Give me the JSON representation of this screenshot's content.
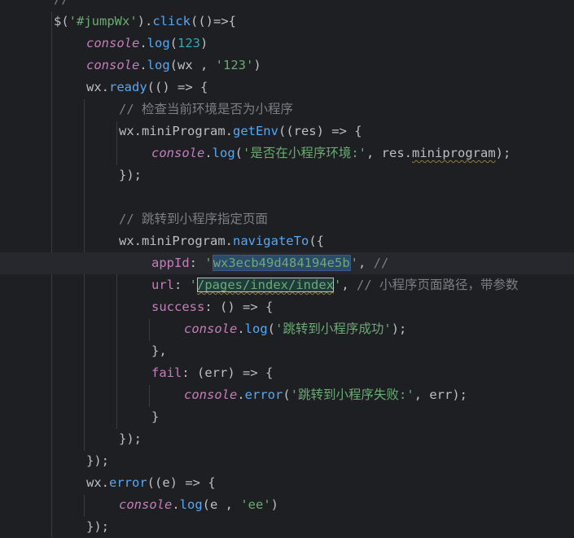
{
  "editor": {
    "lines": [
      {
        "text": "//",
        "indent": 1
      },
      {
        "text": "$('#jumpWx').click(()=>{",
        "indent": 1
      },
      {
        "text": "console.log(123)",
        "indent": 2
      },
      {
        "text": "console.log(wx , '123')",
        "indent": 2
      },
      {
        "text": "wx.ready(() => {",
        "indent": 2
      },
      {
        "text": "// 检查当前环境是否为小程序",
        "indent": 3
      },
      {
        "text": "wx.miniProgram.getEnv((res) => {",
        "indent": 3
      },
      {
        "text": "console.log('是否在小程序环境:', res.miniprogram);",
        "indent": 4
      },
      {
        "text": "});",
        "indent": 3
      },
      {
        "text": "",
        "indent": 0
      },
      {
        "text": "// 跳转到小程序指定页面",
        "indent": 3
      },
      {
        "text": "wx.miniProgram.navigateTo({",
        "indent": 3
      },
      {
        "text": "appId: 'wx3ecb49d484194e5b', //",
        "indent": 4
      },
      {
        "text": "url: '/pages/index/index', // 小程序页面路径，带参数",
        "indent": 4
      },
      {
        "text": "success: () => {",
        "indent": 4
      },
      {
        "text": "console.log('跳转到小程序成功');",
        "indent": 5
      },
      {
        "text": "},",
        "indent": 4
      },
      {
        "text": "fail: (err) => {",
        "indent": 4
      },
      {
        "text": "console.error('跳转到小程序失败:', err);",
        "indent": 5
      },
      {
        "text": "}",
        "indent": 4
      },
      {
        "text": "});",
        "indent": 3
      },
      {
        "text": "});",
        "indent": 2
      },
      {
        "text": "wx.error((e) => {",
        "indent": 2
      },
      {
        "text": "console.log(e , 'ee')",
        "indent": 3
      },
      {
        "text": "});",
        "indent": 2
      }
    ],
    "current_line_index": 12,
    "selected_text": "wx3ecb49d484194e5b",
    "highlighted_text": "/pages/index/index"
  },
  "colors": {
    "background": "#1e1f22",
    "plain": "#bcbec4",
    "console": "#c77dbb",
    "function": "#56a8f5",
    "string": "#6aab73",
    "number": "#2aacb8",
    "comment": "#7a7e85",
    "property": "#c77dbb"
  },
  "icons": [
    "gutter-marker-icon"
  ]
}
